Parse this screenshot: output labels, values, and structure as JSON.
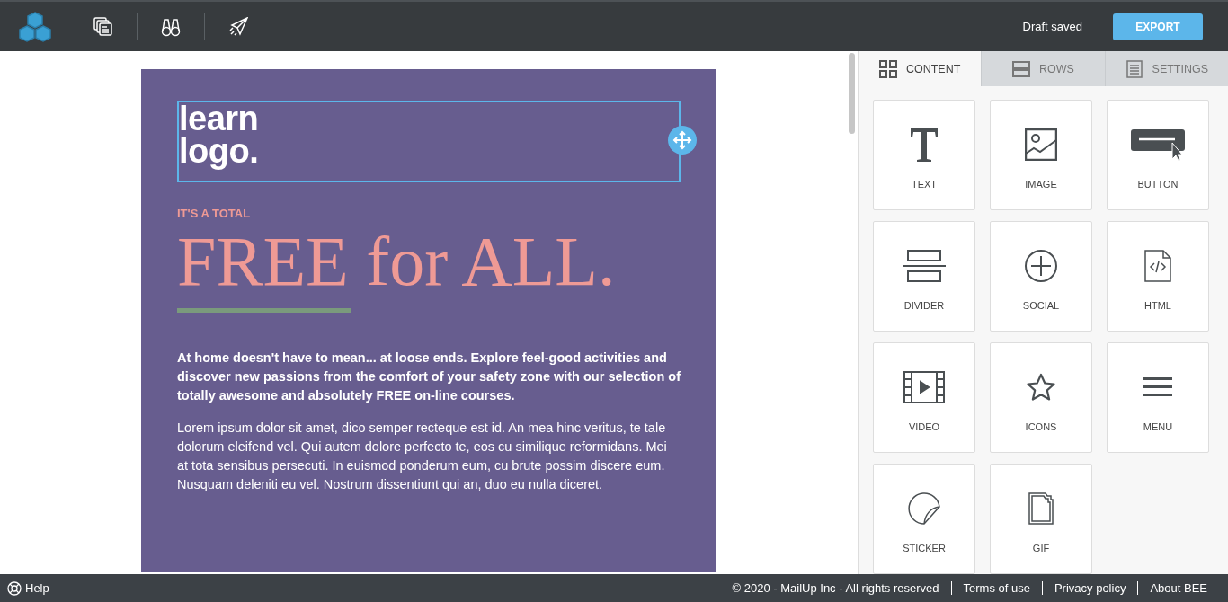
{
  "topbar": {
    "status": "Draft saved",
    "export_label": "EXPORT"
  },
  "email": {
    "logo_lines": [
      "learn",
      "logo."
    ],
    "logo_selected": true,
    "eyebrow": "IT'S A TOTAL",
    "headline": "FREE for ALL.",
    "intro": "At home doesn't have to mean... at loose ends. Explore feel-good activities and discover new passions from the comfort of your safety zone with our selection of totally awesome and absolutely FREE on-line courses.",
    "body": "Lorem ipsum dolor sit amet, dico semper recteque est id. An mea hinc veritus, te tale dolorum eleifend vel. Qui autem dolore perfecto te, eos cu similique reformidans. Mei at tota sensibus persecuti. In euismod ponderum eum, cu brute possim discere eum. Nusquam deleniti eu vel. Nostrum dissentiunt qui an, duo eu nulla diceret."
  },
  "tabs": [
    {
      "kind": "content",
      "label": "CONTENT",
      "selected": true
    },
    {
      "kind": "rows",
      "label": "ROWS",
      "selected": false
    },
    {
      "kind": "settings",
      "label": "SETTINGS",
      "selected": false
    }
  ],
  "blocks": [
    {
      "kind": "text",
      "label": "TEXT"
    },
    {
      "kind": "image",
      "label": "IMAGE"
    },
    {
      "kind": "button",
      "label": "BUTTON"
    },
    {
      "kind": "divider",
      "label": "DIVIDER"
    },
    {
      "kind": "social",
      "label": "SOCIAL"
    },
    {
      "kind": "html",
      "label": "HTML"
    },
    {
      "kind": "video",
      "label": "VIDEO"
    },
    {
      "kind": "icons",
      "label": "ICONS"
    },
    {
      "kind": "menu",
      "label": "MENU"
    },
    {
      "kind": "sticker",
      "label": "STICKER"
    },
    {
      "kind": "gif",
      "label": "GIF"
    }
  ],
  "footer": {
    "help": "Help",
    "copyright": "© 2020 - MailUp Inc - All rights reserved",
    "links": [
      "Terms of use",
      "Privacy policy",
      "About BEE"
    ]
  }
}
